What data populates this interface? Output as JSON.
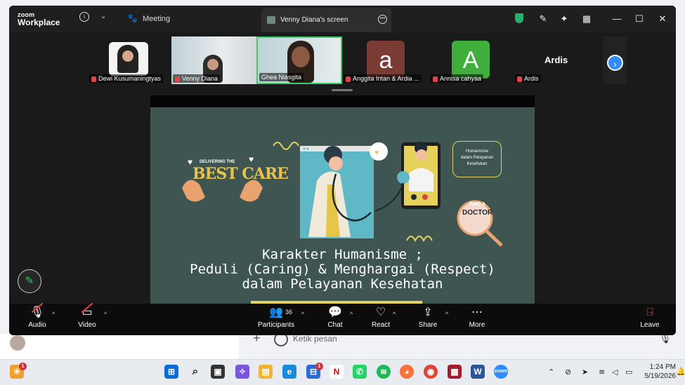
{
  "zoom": {
    "logo_top": "zoom",
    "logo_bottom": "Workplace",
    "meeting_label": "Meeting",
    "share_tab_label": "Venny Diana's screen"
  },
  "participants": [
    {
      "name": "Dewi Kusumaningtyas",
      "type": "video"
    },
    {
      "name": "Venny Diana",
      "type": "video"
    },
    {
      "name": "Ghea Niasgita",
      "type": "video",
      "active_speaker": true
    },
    {
      "name": "Anggita Intan & Ardia ...",
      "type": "avatar",
      "letter": "a",
      "color": "#7a3b34"
    },
    {
      "name": "Annisa cahyaa",
      "type": "avatar",
      "letter": "A",
      "color": "#3fae3d"
    },
    {
      "name": "Ardis",
      "type": "text",
      "display": "Ardis"
    }
  ],
  "slide": {
    "title_line1": "Karakter Humanisme ;",
    "title_line2": "Peduli (Caring) & Menghargai (Respect)",
    "title_line3": "dalam Pelayanan Kesehatan",
    "badge_text_1": "Humanisme",
    "badge_text_2": "dalam Pelayanan",
    "badge_text_3": "Kesehatan",
    "delivering": "DELIVERING THE",
    "best_care": "BEST CARE",
    "find": "FIND A",
    "doctor": "DOCTOR",
    "bg_color": "#3e5552"
  },
  "toolbar": {
    "audio": "Audio",
    "video": "Video",
    "participants": "Participants",
    "participants_count": "36",
    "chat": "Chat",
    "react": "React",
    "share": "Share",
    "more": "More",
    "leave": "Leave"
  },
  "background_app": {
    "input_placeholder": "Ketik pesan"
  },
  "taskbar": {
    "time": "1:24 PM",
    "date": "5/19/2026",
    "weather_badge": "1",
    "store_badge": "1"
  }
}
